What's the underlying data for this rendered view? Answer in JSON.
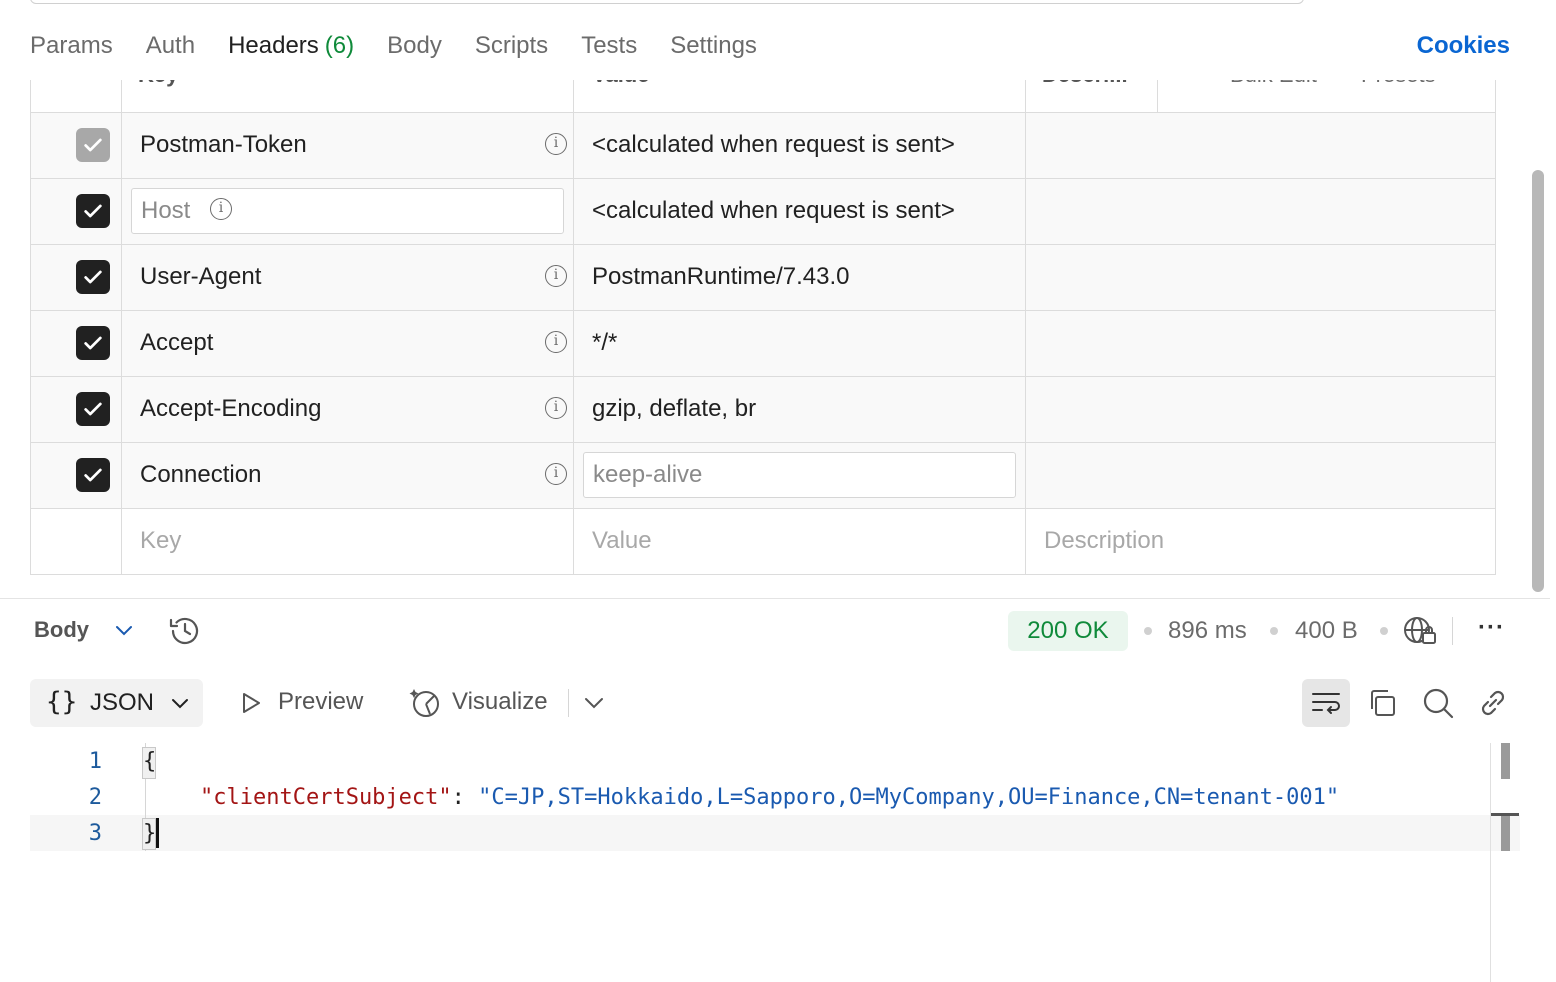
{
  "tabs": [
    {
      "label": "Params"
    },
    {
      "label": "Auth"
    },
    {
      "label": "Headers",
      "count": "(6)",
      "active": true
    },
    {
      "label": "Body"
    },
    {
      "label": "Scripts"
    },
    {
      "label": "Tests"
    },
    {
      "label": "Settings"
    }
  ],
  "cookies_label": "Cookies",
  "table": {
    "columns": {
      "key": "Key",
      "value": "Value",
      "description": "Descri...",
      "bulk_edit": "Bulk Edit",
      "presets": "Presets"
    },
    "rows": [
      {
        "key": "Postman-Token",
        "value": "<calculated when request is sent>",
        "checked": true,
        "disabled": true
      },
      {
        "key": "Host",
        "value": "<calculated when request is sent>",
        "checked": true
      },
      {
        "key": "User-Agent",
        "value": "PostmanRuntime/7.43.0",
        "checked": true
      },
      {
        "key": "Accept",
        "value": "*/*",
        "checked": true
      },
      {
        "key": "Accept-Encoding",
        "value": "gzip, deflate, br",
        "checked": true
      },
      {
        "key": "Connection",
        "value": "keep-alive",
        "checked": true
      }
    ],
    "new_row": {
      "key_placeholder": "Key",
      "value_placeholder": "Value",
      "description_placeholder": "Description"
    }
  },
  "response": {
    "section_label": "Body",
    "status": "200 OK",
    "time": "896 ms",
    "size": "400 B",
    "format": "JSON",
    "preview_label": "Preview",
    "visualize_label": "Visualize",
    "code": {
      "line_numbers": [
        "1",
        "2",
        "3"
      ],
      "open_brace": "{",
      "key": "\"clientCertSubject\"",
      "colon": ": ",
      "value": "\"C=JP,ST=Hokkaido,L=Sapporo,O=MyCompany,OU=Finance,CN=tenant-001\"",
      "close_brace": "}"
    }
  },
  "colors": {
    "accent": "#ff6c37",
    "link": "#0a66d2",
    "success": "#0f8a3a",
    "json_key": "#a31515",
    "json_string": "#1a5ab0"
  }
}
